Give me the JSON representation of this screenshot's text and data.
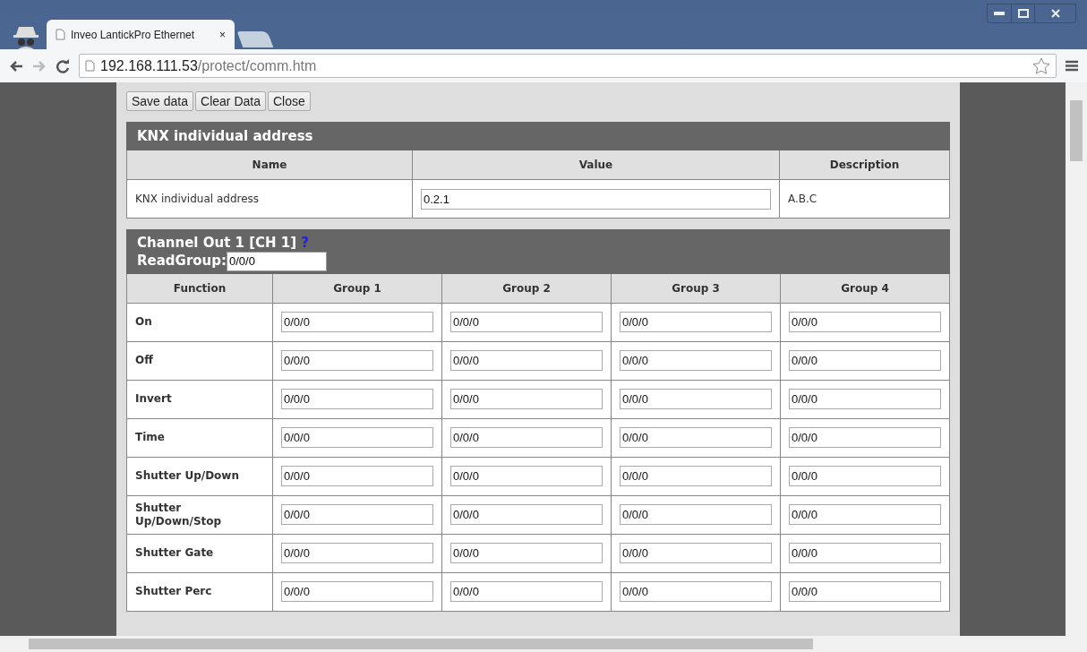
{
  "browser": {
    "tab_title": "Inveo LantickPro Ethernet",
    "tab_close": "×",
    "url_host": "192.168.111.53",
    "url_path": "/protect/comm.htm"
  },
  "buttons": [
    "Save data",
    "Clear Data",
    "Close"
  ],
  "knx_table": {
    "title": "KNX individual address",
    "columns": [
      "Name",
      "Value",
      "Description"
    ],
    "rows": [
      {
        "name": "KNX individual address",
        "value": "0.2.1",
        "description": "A.B.C"
      }
    ]
  },
  "channel": {
    "title": "Channel Out 1 [CH 1]",
    "help": "?",
    "readgroup_label": "ReadGroup:",
    "readgroup_value": "0/0/0",
    "columns": [
      "Function",
      "Group 1",
      "Group 2",
      "Group 3",
      "Group 4"
    ],
    "rows": [
      {
        "function": "On",
        "groups": [
          "0/0/0",
          "0/0/0",
          "0/0/0",
          "0/0/0"
        ]
      },
      {
        "function": "Off",
        "groups": [
          "0/0/0",
          "0/0/0",
          "0/0/0",
          "0/0/0"
        ]
      },
      {
        "function": "Invert",
        "groups": [
          "0/0/0",
          "0/0/0",
          "0/0/0",
          "0/0/0"
        ]
      },
      {
        "function": "Time",
        "groups": [
          "0/0/0",
          "0/0/0",
          "0/0/0",
          "0/0/0"
        ]
      },
      {
        "function": "Shutter Up/Down",
        "groups": [
          "0/0/0",
          "0/0/0",
          "0/0/0",
          "0/0/0"
        ]
      },
      {
        "function": "Shutter Up/Down/Stop",
        "groups": [
          "0/0/0",
          "0/0/0",
          "0/0/0",
          "0/0/0"
        ]
      },
      {
        "function": "Shutter Gate",
        "groups": [
          "0/0/0",
          "0/0/0",
          "0/0/0",
          "0/0/0"
        ]
      },
      {
        "function": "Shutter Perc",
        "groups": [
          "0/0/0",
          "0/0/0",
          "0/0/0",
          "0/0/0"
        ]
      }
    ]
  }
}
